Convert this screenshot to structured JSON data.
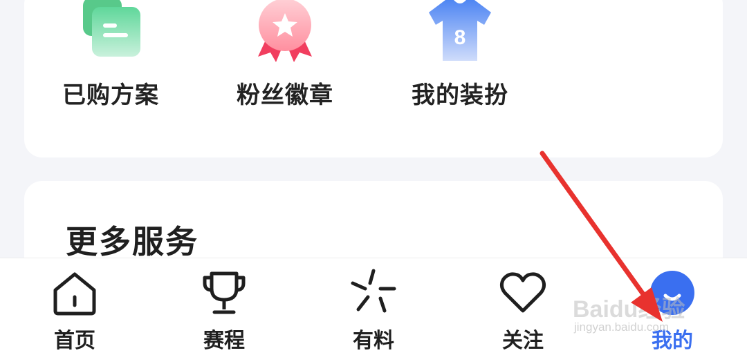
{
  "features": [
    {
      "label": "已购方案",
      "icon": "purchased-plan-icon"
    },
    {
      "label": "粉丝徽章",
      "icon": "fan-badge-icon"
    },
    {
      "label": "我的装扮",
      "icon": "jersey-icon",
      "jersey_number": "8"
    }
  ],
  "more_services": {
    "title": "更多服务"
  },
  "tabbar": {
    "items": [
      {
        "label": "首页",
        "icon": "home-icon"
      },
      {
        "label": "赛程",
        "icon": "trophy-icon"
      },
      {
        "label": "有料",
        "icon": "sparkle-icon"
      },
      {
        "label": "关注",
        "icon": "heart-icon"
      },
      {
        "label": "我的",
        "icon": "profile-icon",
        "active": true
      }
    ]
  },
  "watermark": {
    "brand": "Baidu经验",
    "url": "jingyan.baidu.com"
  },
  "colors": {
    "accent": "#3a6ff0",
    "arrow": "#e8322e",
    "card": "#ffffff",
    "background": "#f4f5f9"
  }
}
